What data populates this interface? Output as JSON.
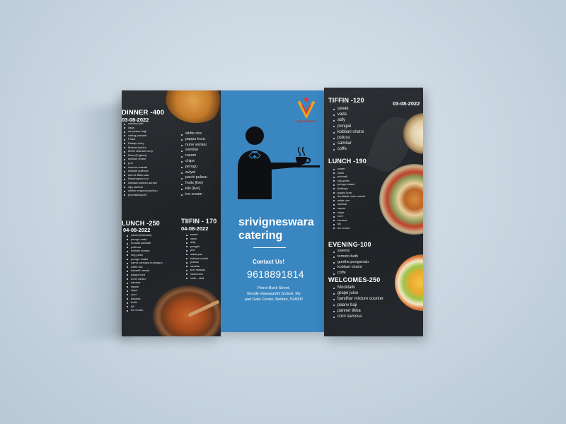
{
  "left_panel": {
    "dinner": {
      "heading": "DINNER -400",
      "date": "03-08-2022",
      "items_a": [
        "sweety burfi",
        "vada",
        "cut peace bujji",
        "rubing pachadi",
        "Pulka",
        "Rasaju curry",
        "Masala kulcha",
        "Methi chaman curry",
        "Dosa [Togiess]",
        "kobbari chatni",
        "puri",
        "channa masala",
        "kobbari pulihora",
        "aloo & tikka sula",
        "Bananapullu kur",
        "raviswa kobbari annam",
        "raju sambar",
        "chilkin enapudai pulusu",
        "ghondakaya fri"
      ],
      "items_b": [
        "white rice",
        "pappu kura",
        "nune vankai",
        "sambar",
        "rasam",
        "chips",
        "perugu",
        "aviyal",
        "pachi pulusu",
        "fruits [live]",
        "kilii [live]",
        "ice cream"
      ]
    },
    "lunch": {
      "heading": "LUNCH -250",
      "date": "04-08-2022",
      "items": [
        "sweet [bobbatlu]",
        "perugu vada",
        "dondali pachadi",
        "pulihora",
        "kobbari annam",
        "veg pulav",
        "perugu chatni",
        "carrot vankaya kurimalpu",
        "white rice",
        "beeartif vankai",
        "pappu kura",
        "nune vanku",
        "sambar",
        "rasam",
        "chips",
        "curd",
        "banana",
        "fruits",
        "kili",
        "ice cream"
      ]
    },
    "tiffin": {
      "heading": "TIIFIN - 170",
      "date": "04-08-2022",
      "items": [
        "sweet",
        "vada",
        "adly",
        "pongali",
        "puri",
        "wada pav",
        "kobbari chatni",
        "pulusu",
        "sambar",
        "puri masala",
        "vada kura",
        "coffe - stall"
      ]
    }
  },
  "middle_panel": {
    "logo_text": "Vigneshwara",
    "brand_line1": "srivigneswara",
    "brand_line2": "catering",
    "contact_label": "Contact Us!",
    "phone": "9618891814",
    "address_line1": "Petrol Bunk Street,",
    "address_line2": "Beside viswasanthi School, My",
    "address_line3": "pad Gate Center, Nellore, 524002"
  },
  "right_panel": {
    "tiffin": {
      "heading": "TIFFIN  -120",
      "date": "03-08-2022",
      "items": [
        "sweet",
        "vada",
        "adly",
        "pongali",
        "kobbari chatni",
        "pulusu",
        "sambar",
        "coffe"
      ]
    },
    "lunch": {
      "heading": "LUNCH  -190",
      "items": [
        "sweet",
        "vada",
        "pachadi",
        "veg-pulav",
        "perugu chatni",
        "thalimpu",
        "pappu kura",
        "dondakai nune vankai",
        "white rice",
        "sambar",
        "rasam",
        "chips",
        "curd",
        "banana",
        "kili",
        "ice cream"
      ]
    },
    "evening": {
      "heading": "EVENING-100",
      "items": [
        "sweets",
        "tomoto bath",
        "guntha ponganalu",
        "kobbari chatni",
        "coffe"
      ]
    },
    "welcomes": {
      "heading": "WELCOMES-250",
      "items": [
        "Mocktails",
        "grape juice",
        "bandhar mixture counter",
        "paanv baji",
        "panner tikka",
        "corn samosa"
      ]
    }
  },
  "colors": {
    "background": "#cfdae4",
    "panel_dark": "#25292d",
    "panel_blue": "#3a86c0",
    "text_light": "#ffffff"
  }
}
